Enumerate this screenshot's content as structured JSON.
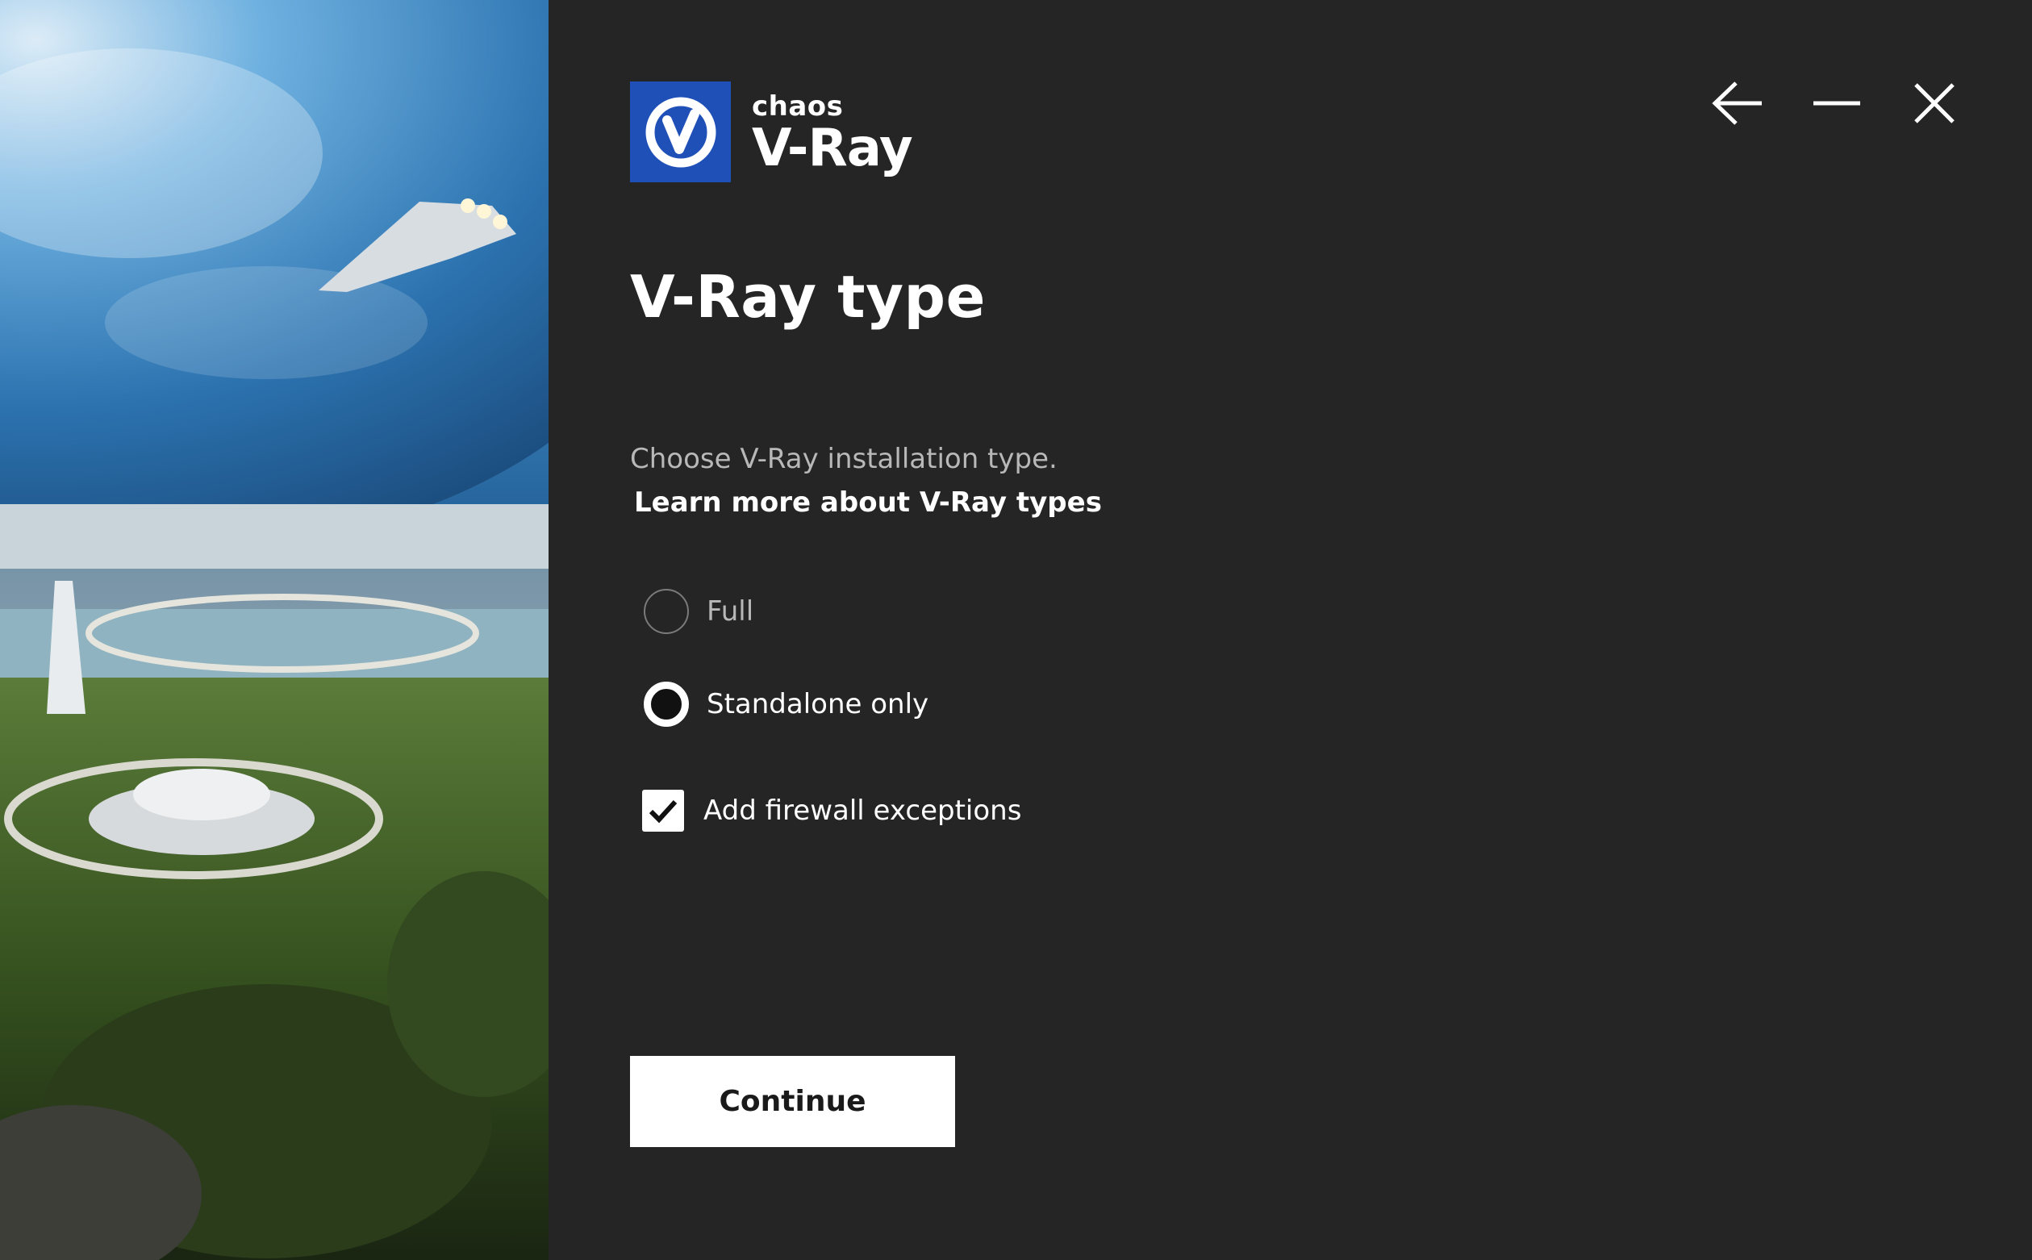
{
  "app": {
    "brand": "chaos",
    "product": "V-Ray"
  },
  "window_controls": {
    "back_icon": "arrow-left-icon",
    "minimize_icon": "minimize-icon",
    "close_icon": "close-icon"
  },
  "page": {
    "title": "V-Ray type",
    "subtitle": "Choose V-Ray installation type.",
    "learn_more": "Learn more about V-Ray types"
  },
  "options": [
    {
      "label": "Full",
      "selected": false
    },
    {
      "label": "Standalone only",
      "selected": true
    }
  ],
  "firewall": {
    "label": "Add firewall exceptions",
    "checked": true
  },
  "actions": {
    "continue_label": "Continue"
  },
  "colors": {
    "background": "#252525",
    "logo_blue": "#1f50b8",
    "text_primary": "#ffffff",
    "text_secondary": "#b8b8b8",
    "button_bg": "#ffffff"
  }
}
